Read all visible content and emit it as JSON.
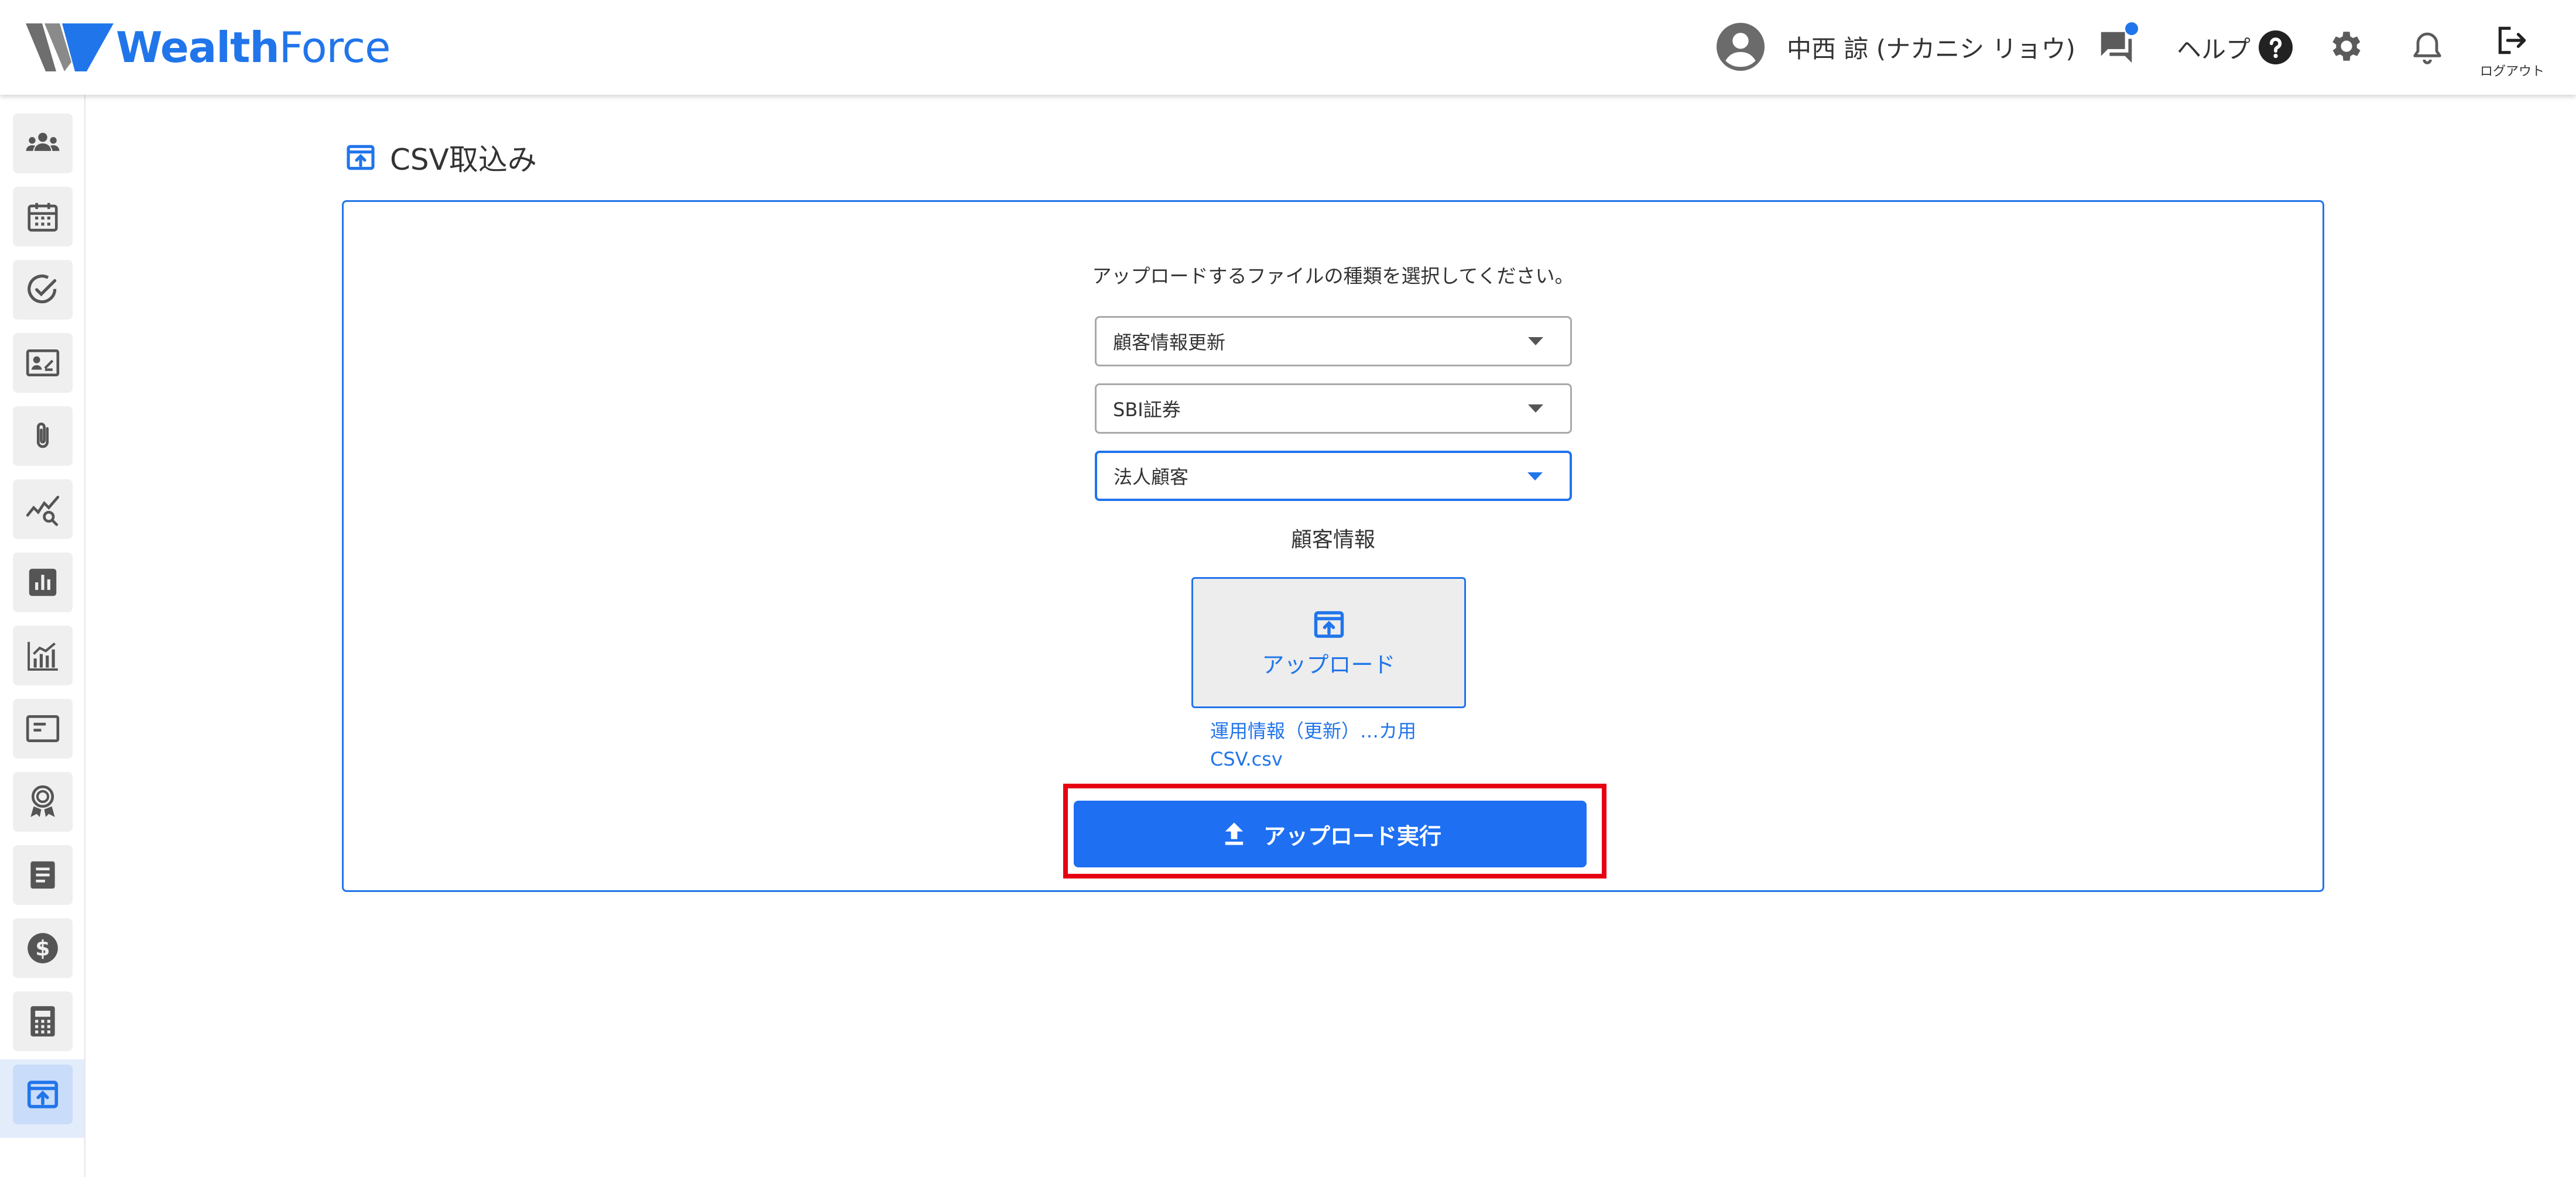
{
  "header": {
    "logo_text_bold": "Wealth",
    "logo_text_light": "Force",
    "user_name": "中西 諒 (ナカニシ リョウ)",
    "help_label": "ヘルプ",
    "logout_label": "ログアウト"
  },
  "sidebar": {
    "items": [
      {
        "icon": "people-icon"
      },
      {
        "icon": "calendar-icon"
      },
      {
        "icon": "check-circle-icon"
      },
      {
        "icon": "contact-card-icon"
      },
      {
        "icon": "paperclip-icon"
      },
      {
        "icon": "trend-search-icon"
      },
      {
        "icon": "bar-chart-icon"
      },
      {
        "icon": "growth-chart-icon"
      },
      {
        "icon": "panel-icon"
      },
      {
        "icon": "award-icon"
      },
      {
        "icon": "document-icon"
      },
      {
        "icon": "dollar-icon"
      },
      {
        "icon": "calculator-icon"
      },
      {
        "icon": "upload-icon",
        "active": true
      }
    ]
  },
  "main": {
    "page_title": "CSV取込み",
    "instruction": "アップロードするファイルの種類を選択してください。",
    "selects": [
      {
        "value": "顧客情報更新"
      },
      {
        "value": "SBI証券"
      },
      {
        "value": "法人顧客"
      }
    ],
    "section_label": "顧客情報",
    "upload_box_label": "アップロード",
    "file_name": "運用情報（更新）…カ用CSV.csv",
    "execute_button_label": "アップロード実行"
  },
  "colors": {
    "accent": "#2175ea",
    "execute_button": "#1e6ff2",
    "highlight": "#e60012"
  }
}
